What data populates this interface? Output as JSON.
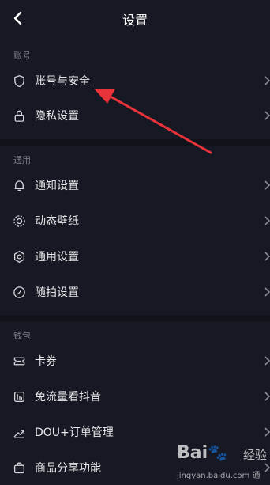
{
  "header": {
    "title": "设置"
  },
  "sections": {
    "account": "账号",
    "general": "通用",
    "wallet": "钱包"
  },
  "rows": {
    "account_security": "账号与安全",
    "privacy": "隐私设置",
    "notifications": "通知设置",
    "live_wallpaper": "动态壁纸",
    "general_settings": "通用设置",
    "shoot_settings": "随拍设置",
    "coupons": "卡券",
    "free_data": "免流量看抖音",
    "dou_orders": "DOU+订单管理",
    "product_share": "商品分享功能"
  },
  "annotation": {
    "arrow_color": "#e8333a"
  },
  "watermark": {
    "logo_left": "Bai",
    "logo_paw": "🐾",
    "logo_right": "经验",
    "url": "jingyan.baidu.com",
    "overlap_text": "通"
  }
}
